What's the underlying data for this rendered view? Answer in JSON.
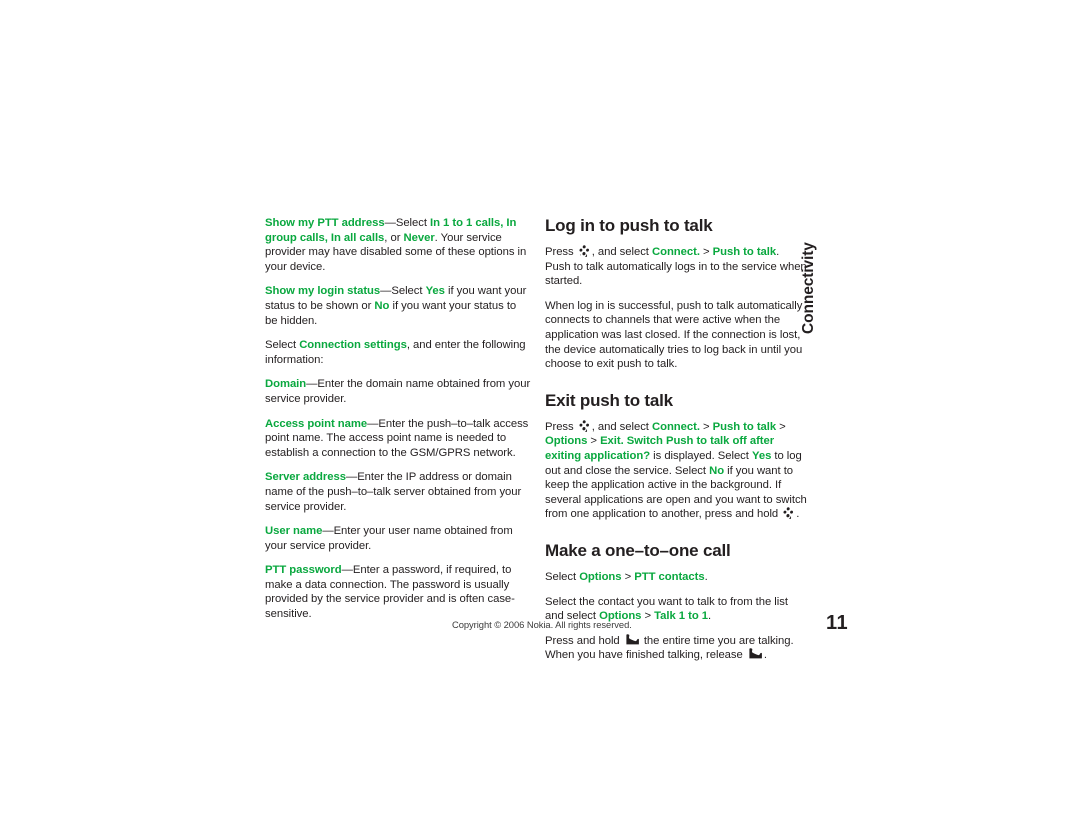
{
  "document": {
    "chapter_tab": "Connectivity",
    "page_number": "11",
    "copyright": "Copyright © 2006 Nokia. All rights reserved."
  },
  "left_column": {
    "paragraphs": {
      "show_my_ptt_address": {
        "term": "Show my PTT address",
        "dash": "—Select ",
        "opt1": "In 1 to 1 calls, In group calls, In all calls",
        "mid": ", or ",
        "opt2": "Never",
        "tail": ". Your service provider may have disabled some of these options in your device."
      },
      "show_my_login_status": {
        "term": "Show my login status",
        "dash": "—Select ",
        "opt_yes": "Yes",
        "mid": " if you want your status to be shown or ",
        "opt_no": "No",
        "tail": " if you want your status to be hidden."
      },
      "connection_settings": {
        "lead": "Select ",
        "term": "Connection settings",
        "tail": ", and enter the following information:"
      },
      "domain": {
        "term": "Domain",
        "tail": "—Enter the domain name obtained from your service provider."
      },
      "access_point_name": {
        "term": "Access point name",
        "tail": "—Enter the push–to–talk access point name. The access point name is needed to establish a connection to the GSM/GPRS network."
      },
      "server_address": {
        "term": "Server address",
        "tail": "—Enter the IP address or domain name of the push–to–talk server obtained from your service provider."
      },
      "user_name": {
        "term": "User name",
        "tail": "—Enter your user name obtained from your service provider."
      },
      "ptt_password": {
        "term": "PTT password",
        "tail": "—Enter a password, if required, to make a data connection. The password is usually provided by the service provider and is often case-sensitive."
      }
    }
  },
  "right_column": {
    "sections": {
      "log_in": {
        "heading": "Log in to push to talk",
        "p1": {
          "lead": "Press ",
          "menu_key_icon": "menu-key-icon",
          "after_key": ", and select ",
          "path1": "Connect.",
          "sep": " > ",
          "path2": "Push to talk",
          "tail": ". Push to talk automatically logs in to the service when started."
        },
        "p2": "When log in is successful, push to talk automatically connects to channels that were active when the application was last closed. If the connection is lost, the device automatically tries to log back in until you choose to exit push to talk."
      },
      "exit": {
        "heading": "Exit push to talk",
        "p1": {
          "lead": "Press ",
          "menu_key_icon": "menu-key-icon",
          "after_key": ", and select ",
          "path1": "Connect.",
          "sep1": " > ",
          "path2": "Push to talk",
          "sep2": " > ",
          "path3": "Options",
          "sep3": " > ",
          "path4": "Exit.",
          "prompt": " Switch Push to talk off after exiting application?",
          "mid1": " is displayed. Select ",
          "opt_yes": "Yes",
          "mid2": " to log out and close the service. Select ",
          "opt_no": "No",
          "mid3": " if you want to keep the application active in the background. If several applications are open and you want to switch from one application to another, press and hold ",
          "end_key_icon": "menu-key-icon",
          "tail": "."
        }
      },
      "one_to_one": {
        "heading": "Make a one–to–one call",
        "p1": {
          "lead": "Select ",
          "path1": "Options",
          "sep": " > ",
          "path2": "PTT contacts",
          "tail": "."
        },
        "p2": {
          "lead": "Select the contact you want to talk to from the list and select ",
          "path1": "Options",
          "sep": " > ",
          "path2": "Talk 1 to 1",
          "tail": "."
        },
        "p3": {
          "lead": "Press and hold ",
          "call_key_icon": "call-key-icon",
          "mid": " the entire time you are talking. When you have finished talking, release ",
          "call_key_icon2": "call-key-icon",
          "tail": "."
        }
      }
    }
  },
  "colors": {
    "accent_green": "#0aa83f",
    "body_text": "#231f20",
    "page_background": "#ffffff"
  }
}
